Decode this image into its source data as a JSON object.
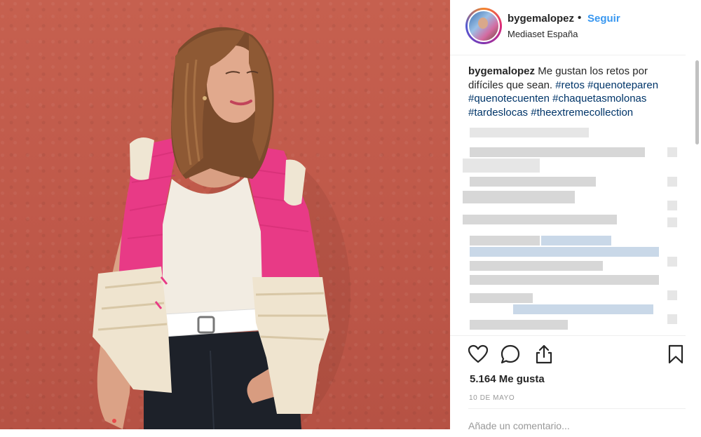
{
  "post": {
    "image_alt": "",
    "author": {
      "username": "bygemalopez",
      "separator": "•",
      "follow_label": "Seguir",
      "location": "Mediaset España"
    },
    "caption": {
      "username": "bygemalopez",
      "text": "Me gustan los retos por difíciles que sean.",
      "hashtags": [
        "#retos",
        "#quenoteparen",
        "#quenotecuenten",
        "#chaquetasmolonas",
        "#tardeslocas",
        "#theextremecollection"
      ]
    },
    "comments": {
      "pixelated": true
    },
    "likes_text": "5.164 Me gusta",
    "date_text": "10 DE MAYO",
    "comment_placeholder": "Añade un comentario..."
  },
  "icons": {
    "like": "heart-icon",
    "comment": "comment-icon",
    "share": "share-icon",
    "save": "bookmark-icon"
  },
  "colors": {
    "link": "#3897f0",
    "hashtag": "#003569",
    "text": "#262626",
    "muted": "#999999",
    "jacket": "#e83a86",
    "wall": "#c2594b"
  }
}
